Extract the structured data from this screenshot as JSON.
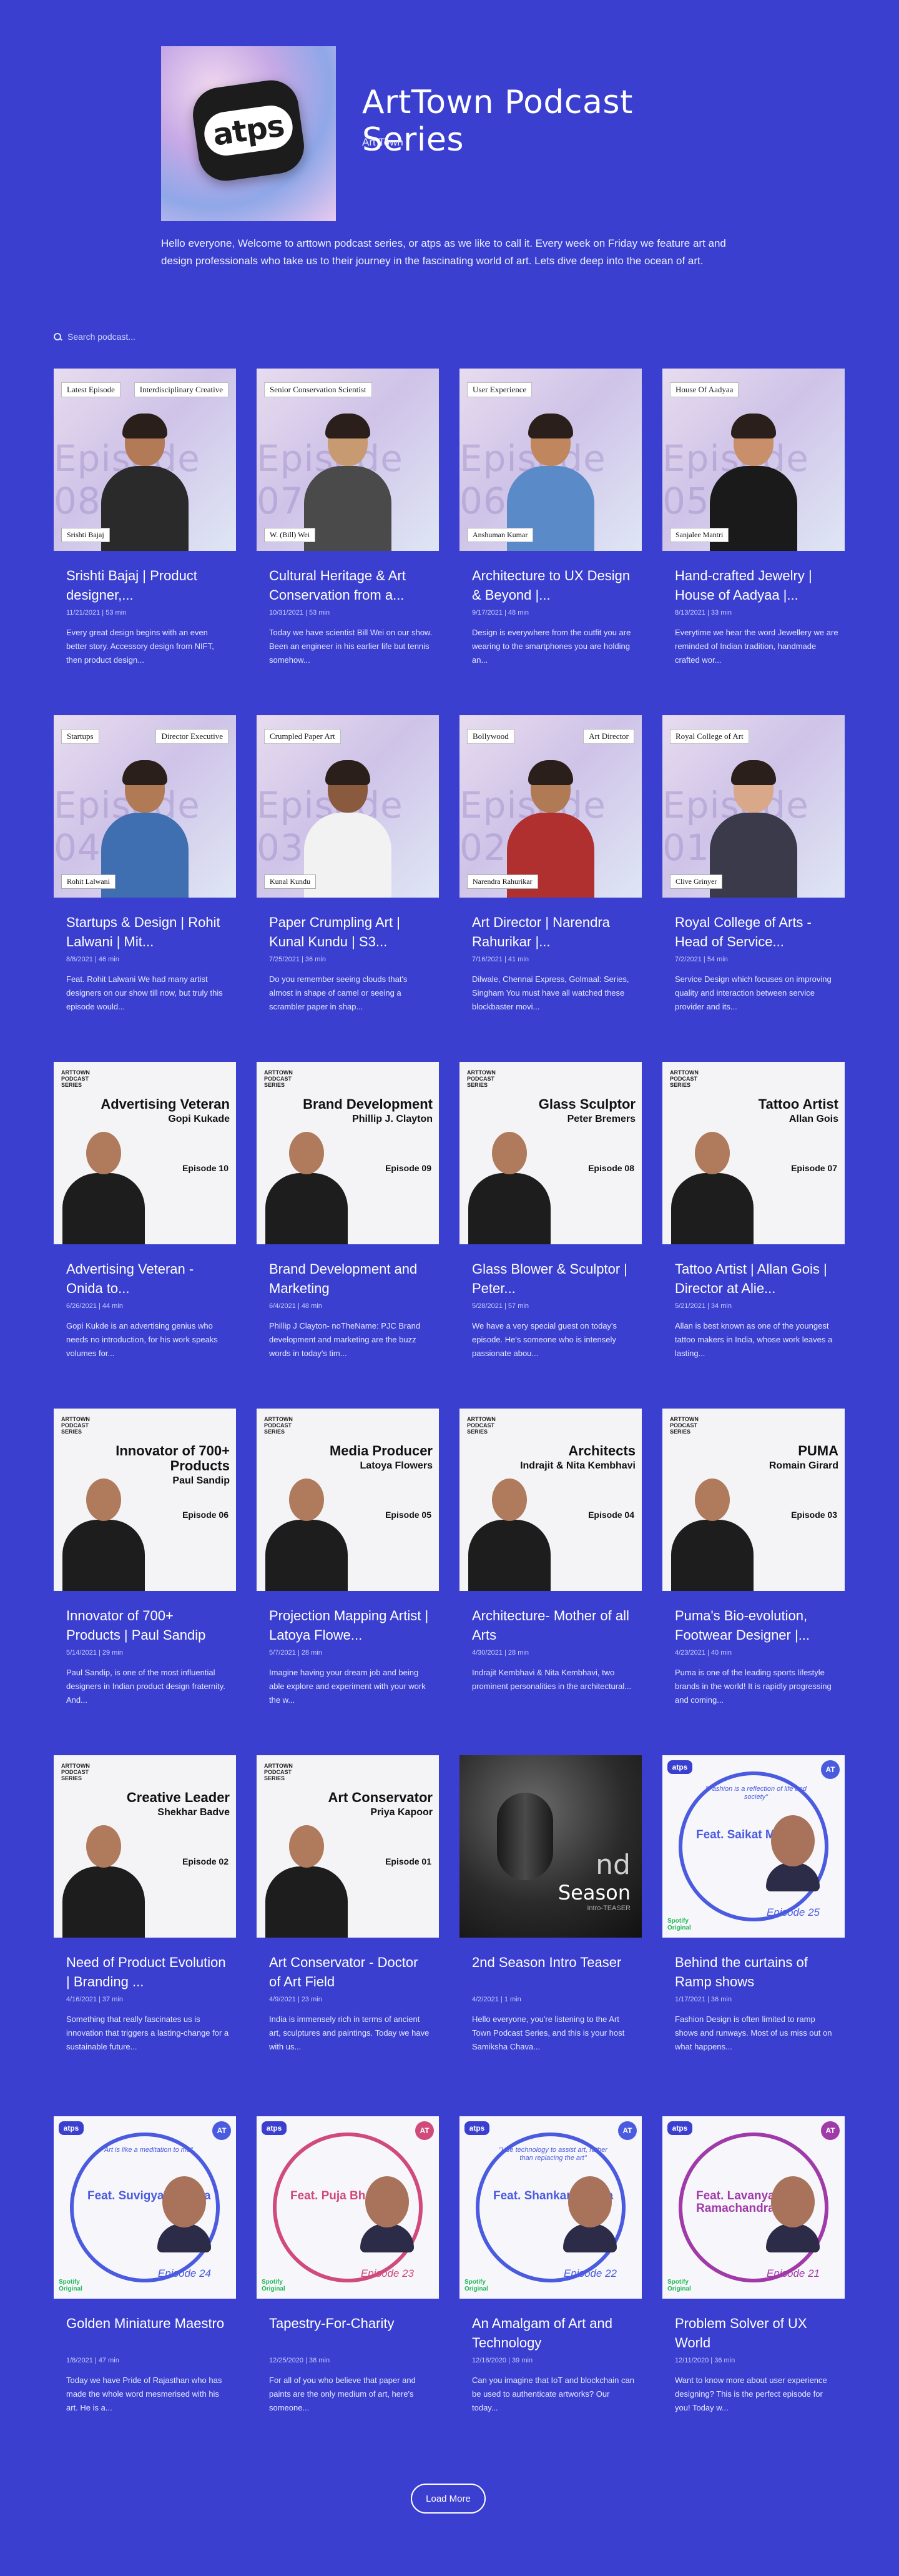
{
  "podcast": {
    "title": "ArtTown Podcast Series",
    "author": "Art Town",
    "logo_text": "atps",
    "description": "Hello everyone, Welcome to arttown podcast series, or atps as we like to call it. Every week on Friday we feature art and design professionals who take us to their journey in the fascinating world of art. Lets dive deep into the ocean of art."
  },
  "search": {
    "placeholder": "Search podcast..."
  },
  "load_more": "Load More",
  "episodes": [
    {
      "title": "Srishti Bajaj | Product designer,...",
      "date": "11/21/2021",
      "duration": "53 min",
      "desc": "Every great design begins with an even better story. Accessory design from NIFT, then product design...",
      "thumb": {
        "style": "photo",
        "tag": "Latest Episode",
        "tag2": "Interdisciplinary Creative",
        "ep": "Episode 08",
        "name": "Srishti Bajaj",
        "skin": "#b37a58",
        "shirt": "#2a2a2a"
      }
    },
    {
      "title": "Cultural Heritage & Art Conservation from a...",
      "date": "10/31/2021",
      "duration": "53 min",
      "desc": "Today we have scientist Bill Wei on our show. Been an engineer in his earlier life but tennis somehow...",
      "thumb": {
        "style": "photo",
        "tag": "Senior Conservation Scientist",
        "ep": "Episode 07",
        "name": "W. (Bill) Wei",
        "skin": "#c89a72",
        "shirt": "#4a4a4a"
      }
    },
    {
      "title": "Architecture to UX Design & Beyond |...",
      "date": "9/17/2021",
      "duration": "48 min",
      "desc": "Design is everywhere from the outfit you are wearing to the smartphones you are holding an...",
      "thumb": {
        "style": "photo",
        "tag": "User Experience",
        "ep": "Episode 06",
        "name": "Anshuman Kumar",
        "skin": "#c0875e",
        "shirt": "#5a8ac8"
      }
    },
    {
      "title": "Hand-crafted Jewelry | House of Aadyaa |...",
      "date": "8/13/2021",
      "duration": "33 min",
      "desc": "Everytime we hear the word Jewellery we are reminded of Indian tradition, handmade crafted wor...",
      "thumb": {
        "style": "photo",
        "tag": "House Of Aadyaa",
        "ep": "Episode 05",
        "name": "Sanjalee Mantri",
        "skin": "#c98e6a",
        "shirt": "#1a1a1a"
      }
    },
    {
      "title": "Startups & Design | Rohit Lalwani | Mit...",
      "date": "8/8/2021",
      "duration": "46 min",
      "desc": "Feat. Rohit Lalwani We had many artist designers on our show till now, but truly this episode would...",
      "thumb": {
        "style": "photo",
        "tag": "Startups",
        "tag2": "Director Executive",
        "ep": "Episode 04",
        "name": "Rohit Lalwani",
        "skin": "#b07a55",
        "shirt": "#3f6fb0"
      }
    },
    {
      "title": "Paper Crumpling Art | Kunal Kundu | S3...",
      "date": "7/25/2021",
      "duration": "36 min",
      "desc": "Do you remember seeing clouds that's almost in shape of camel or seeing a scrambler paper in shap...",
      "thumb": {
        "style": "photo",
        "tag": "Crumpled Paper Art",
        "ep": "Episode 03",
        "name": "Kunal Kundu",
        "skin": "#8a5a3e",
        "shirt": "#f2f2f2"
      }
    },
    {
      "title": "Art Director | Narendra Rahurikar |...",
      "date": "7/16/2021",
      "duration": "41 min",
      "desc": "Dilwale, Chennai Express, Golmaal: Series, Singham You must have all watched these blockbaster movi...",
      "thumb": {
        "style": "photo",
        "tag": "Bollywood",
        "tag2": "Art Director",
        "ep": "Episode 02",
        "name": "Narendra Rahurikar",
        "skin": "#b07a55",
        "shirt": "#b03030"
      }
    },
    {
      "title": "Royal College of Arts - Head of Service...",
      "date": "7/2/2021",
      "duration": "54 min",
      "desc": "Service Design which focuses on improving quality and interaction between service provider and its...",
      "thumb": {
        "style": "photo",
        "tag": "Royal College of Art",
        "ep": "Episode 01",
        "name": "Clive Grinyer",
        "skin": "#d8a888",
        "shirt": "#3a3a4a"
      }
    },
    {
      "title": "Advertising Veteran - Onida to...",
      "date": "6/26/2021",
      "duration": "44 min",
      "desc": "Gopi Kukde is an advertising genius who needs no introduction, for his work speaks volumes for...",
      "thumb": {
        "style": "poster",
        "headline": "Advertising Veteran",
        "name": "Gopi Kukade",
        "ep": "Episode 10"
      }
    },
    {
      "title": "Brand Development and Marketing",
      "date": "6/4/2021",
      "duration": "48 min",
      "desc": "Phillip J Clayton- noTheName: PJC Brand development and marketing are the buzz words in today's tim...",
      "thumb": {
        "style": "poster",
        "headline": "Brand Development",
        "name": "Phillip J. Clayton",
        "ep": "Episode 09"
      }
    },
    {
      "title": "Glass Blower & Sculptor | Peter...",
      "date": "5/28/2021",
      "duration": "57 min",
      "desc": "We have a very special guest on today's episode. He's someone who is intensely passionate abou...",
      "thumb": {
        "style": "poster",
        "headline": "Glass Sculptor",
        "name": "Peter Bremers",
        "ep": "Episode 08"
      }
    },
    {
      "title": "Tattoo Artist | Allan Gois | Director at Alie...",
      "date": "5/21/2021",
      "duration": "34 min",
      "desc": "Allan is best known as one of the youngest tattoo makers in India, whose work leaves a lasting...",
      "thumb": {
        "style": "poster",
        "headline": "Tattoo Artist",
        "name": "Allan Gois",
        "ep": "Episode 07"
      }
    },
    {
      "title": "Innovator of 700+ Products | Paul Sandip",
      "date": "5/14/2021",
      "duration": "29 min",
      "desc": "Paul Sandip, is one of the most influential designers in Indian product design fraternity. And...",
      "thumb": {
        "style": "poster",
        "headline": "Innovator of 700+ Products",
        "name": "Paul Sandip",
        "ep": "Episode 06"
      }
    },
    {
      "title": "Projection Mapping Artist | Latoya Flowe...",
      "date": "5/7/2021",
      "duration": "28 min",
      "desc": "Imagine having your dream job and being able explore and experiment with your work the w...",
      "thumb": {
        "style": "poster",
        "headline": "Media Producer",
        "name": "Latoya Flowers",
        "ep": "Episode 05"
      }
    },
    {
      "title": "Architecture- Mother of all Arts",
      "date": "4/30/2021",
      "duration": "28 min",
      "desc": "Indrajit Kembhavi & Nita Kembhavi, two prominent personalities in the architectural...",
      "thumb": {
        "style": "poster",
        "headline": "Architects",
        "name": "Indrajit & Nita Kembhavi",
        "ep": "Episode 04"
      }
    },
    {
      "title": "Puma's Bio-evolution, Footwear Designer |...",
      "date": "4/23/2021",
      "duration": "40 min",
      "desc": "Puma is one of the leading sports lifestyle brands in the world! It is rapidly progressing and coming...",
      "thumb": {
        "style": "poster",
        "headline": "PUMA",
        "name": "Romain Girard",
        "ep": "Episode 03"
      }
    },
    {
      "title": "Need of Product Evolution | Branding ...",
      "date": "4/16/2021",
      "duration": "37 min",
      "desc": "Something that really fascinates us is innovation that triggers a lasting-change for a sustainable future...",
      "thumb": {
        "style": "poster",
        "headline": "Creative Leader",
        "name": "Shekhar Badve",
        "ep": "Episode 02"
      }
    },
    {
      "title": "Art Conservator - Doctor of Art Field",
      "date": "4/9/2021",
      "duration": "23 min",
      "desc": "India is immensely rich in terms of ancient art, sculptures and paintings. Today we have with us...",
      "thumb": {
        "style": "poster",
        "headline": "Art Conservator",
        "name": "Priya Kapoor",
        "ep": "Episode 01"
      }
    },
    {
      "title": "2nd Season Intro Teaser",
      "date": "4/2/2021",
      "duration": "1 min",
      "desc": "Hello everyone, you're listening to the Art Town Podcast Series, and this is your host Samiksha Chava...",
      "thumb": {
        "style": "season",
        "nd": "nd",
        "season": "Season",
        "sub": "Intro-TEASER"
      }
    },
    {
      "title": "Behind the curtains of Ramp shows",
      "date": "1/17/2021",
      "duration": "36 min",
      "desc": "Fashion Design is often limited to ramp shows and runways. Most of us miss out on what happens...",
      "thumb": {
        "style": "spotify",
        "quote": "\"Fashion is a reflection of life and society\"",
        "feat": "Feat. Saikat Mitra",
        "ep": "Episode 25",
        "color": "#4a5be0",
        "at": "AT"
      }
    },
    {
      "title": "Golden Miniature Maestro",
      "date": "1/8/2021",
      "duration": "47 min",
      "desc": "Today we have Pride of Rajasthan who has made the whole word mesmerised with his art. He is a...",
      "thumb": {
        "style": "spotify",
        "quote": "\"Art is like a meditation to me\"",
        "feat": "Feat. Suvigya Sharma",
        "ep": "Episode 24",
        "color": "#4a5be0",
        "at": "AT"
      }
    },
    {
      "title": "Tapestry-For-Charity",
      "date": "12/25/2020",
      "duration": "38 min",
      "desc": "For all of you who believe that paper and paints are the only medium of art, here's someone...",
      "thumb": {
        "style": "spotify",
        "quote": "",
        "feat": "Feat. Puja Bhakoo",
        "ep": "Episode 23",
        "color": "#d04a7a",
        "at": "AT"
      }
    },
    {
      "title": "An Amalgam of Art and Technology",
      "date": "12/18/2020",
      "duration": "39 min",
      "desc": "Can you imagine that IoT and blockchain can be used to authenticate artworks? Our today...",
      "thumb": {
        "style": "spotify",
        "quote": "\"Use technology to assist art, rather than replacing the art\"",
        "feat": "Feat. Shankar Mridha",
        "ep": "Episode 22",
        "color": "#4a5be0",
        "at": "AT"
      }
    },
    {
      "title": "Problem Solver of UX World",
      "date": "12/11/2020",
      "duration": "36 min",
      "desc": "Want to know more about user experience designing? This is the perfect episode for you! Today w...",
      "thumb": {
        "style": "spotify",
        "quote": "",
        "feat": "Feat. Lavanya Ramachandran",
        "ep": "Episode 21",
        "color": "#a03aa8",
        "at": "AT"
      }
    }
  ]
}
